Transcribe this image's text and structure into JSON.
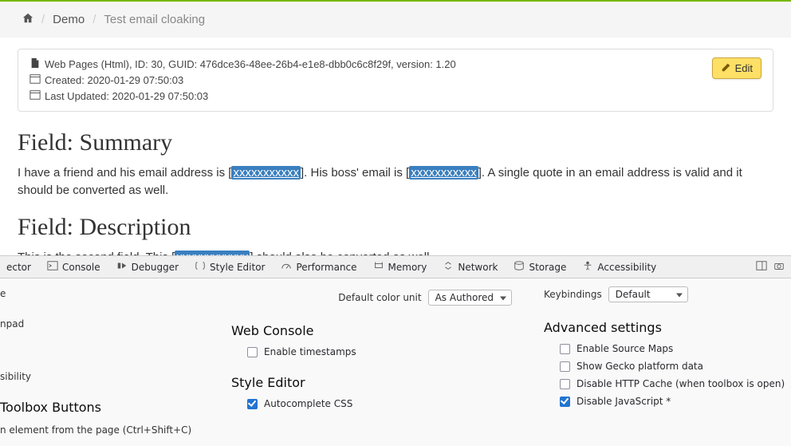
{
  "breadcrumb": {
    "home_icon": "home",
    "items": [
      "Demo",
      "Test email cloaking"
    ]
  },
  "info": {
    "page_meta": "Web Pages (Html), ID: 30, GUID: 476dce36-48ee-26b4-e1e8-dbb0c6c8f29f, version: 1.20",
    "created": "Created: 2020-01-29 07:50:03",
    "updated": "Last Updated: 2020-01-29 07:50:03",
    "edit_label": "Edit"
  },
  "fields": {
    "summary_heading": "Field: Summary",
    "summary_pre1": "I have a friend and his email address is [",
    "summary_mask1": "xxxxxxxxxxx",
    "summary_mid": "].  His boss' email is [",
    "summary_mask2": "xxxxxxxxxxx",
    "summary_post": "]. A single quote in an email address is valid and it should be converted as well.",
    "desc_heading": "Field: Description",
    "desc_pre": "This is the second field. This [",
    "desc_mask": "xxxxxxxxxxxx",
    "desc_post": "] should also be converted as well."
  },
  "devtools": {
    "tabs": [
      "ector",
      "Console",
      "Debugger",
      "Style Editor",
      "Performance",
      "Memory",
      "Network",
      "Storage",
      "Accessibility"
    ],
    "left": {
      "item1": "e",
      "item2": "npad",
      "item3": "sibility",
      "buttons_heading": "Toolbox Buttons",
      "pick_element": "n element from the page (Ctrl+Shift+C)"
    },
    "mid": {
      "default_color_label": "Default color unit",
      "default_color_value": "As Authored",
      "web_console_heading": "Web Console",
      "enable_timestamps": "Enable timestamps",
      "style_editor_heading": "Style Editor",
      "autocomplete_css": "Autocomplete CSS"
    },
    "right": {
      "keybindings_label": "Keybindings",
      "keybindings_value": "Default",
      "advanced_heading": "Advanced settings",
      "enable_source_maps": "Enable Source Maps",
      "show_gecko": "Show Gecko platform data",
      "disable_http_cache": "Disable HTTP Cache (when toolbox is open)",
      "disable_js": "Disable JavaScript *"
    }
  }
}
